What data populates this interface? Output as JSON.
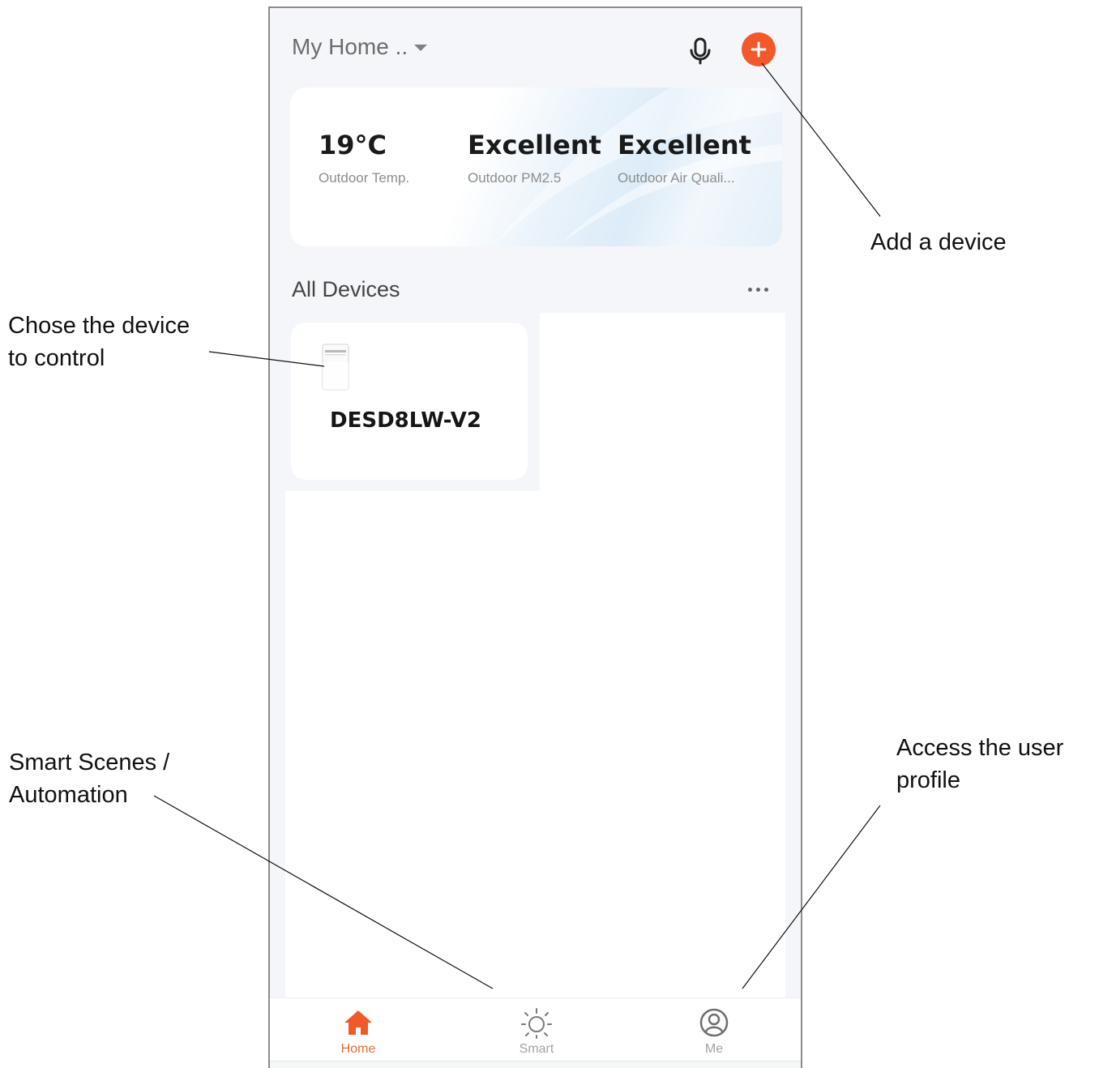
{
  "annotations": {
    "add_device": "Add a device",
    "choose_device": [
      "Chose the device",
      "to control"
    ],
    "smart_scenes": [
      "Smart Scenes /",
      "Automation"
    ],
    "user_profile": [
      "Access the user",
      "profile"
    ]
  },
  "header": {
    "home_name": "My Home ..",
    "mic_icon": "microphone-icon",
    "add_icon": "plus-icon",
    "accent_color": "#f2582a"
  },
  "weather": [
    {
      "value": "19°C",
      "label": "Outdoor Temp."
    },
    {
      "value": "Excellent",
      "label": "Outdoor PM2.5"
    },
    {
      "value": "Excellent",
      "label": "Outdoor Air Quali..."
    }
  ],
  "devices_section": {
    "title": "All Devices",
    "more_icon": "more-horizontal-icon",
    "devices": [
      {
        "name": "DESD8LW-V2",
        "icon": "dehumidifier-icon"
      }
    ]
  },
  "tabs": [
    {
      "label": "Home",
      "icon": "home-icon",
      "active": true
    },
    {
      "label": "Smart",
      "icon": "sun-icon",
      "active": false
    },
    {
      "label": "Me",
      "icon": "user-profile-icon",
      "active": false
    }
  ]
}
